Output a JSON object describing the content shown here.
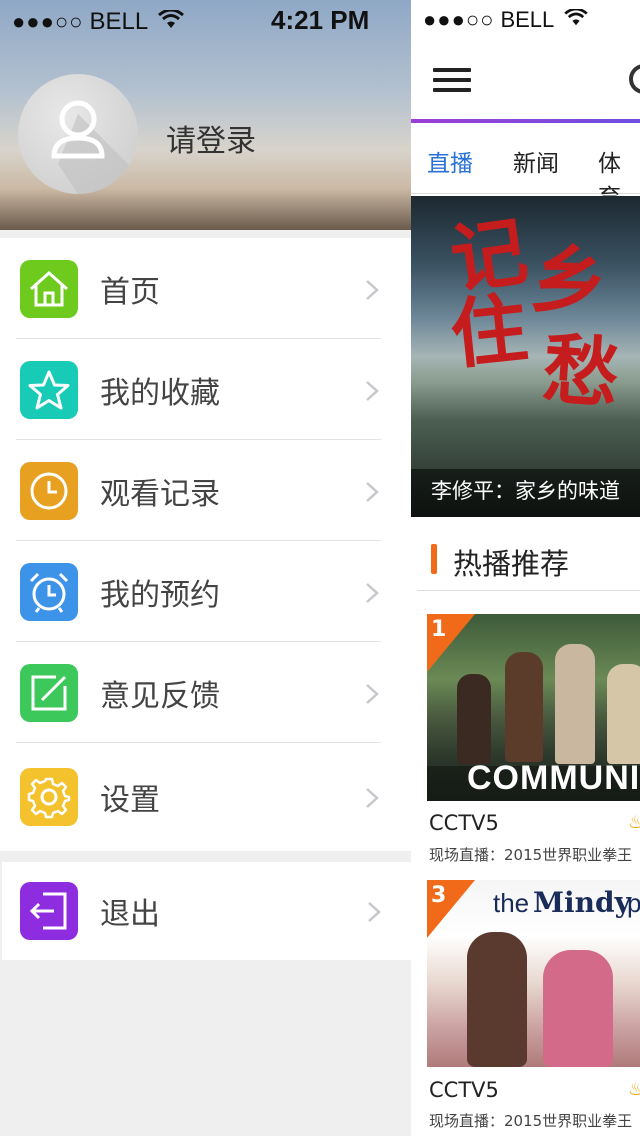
{
  "left_status": {
    "signal": "●●●○○",
    "carrier": "BELL",
    "time": "4:21 PM"
  },
  "profile": {
    "login_label": "请登录"
  },
  "menu": {
    "items": [
      {
        "label": "首页",
        "icon": "home-icon",
        "color": "#6ecb1e"
      },
      {
        "label": "我的收藏",
        "icon": "star-icon",
        "color": "#17cbb7"
      },
      {
        "label": "观看记录",
        "icon": "clock-icon",
        "color": "#e8a020"
      },
      {
        "label": "我的预约",
        "icon": "alarm-icon",
        "color": "#3d93e8"
      },
      {
        "label": "意见反馈",
        "icon": "edit-icon",
        "color": "#3cc85a"
      },
      {
        "label": "设置",
        "icon": "gear-icon",
        "color": "#f4c22c"
      }
    ],
    "exit": {
      "label": "退出",
      "icon": "logout-icon",
      "color": "#8e2de0"
    }
  },
  "right_status": {
    "signal": "●●●○○",
    "carrier": "BELL"
  },
  "tabs": [
    {
      "label": "直播",
      "active": true
    },
    {
      "label": "新闻",
      "active": false
    },
    {
      "label": "体育",
      "active": false
    }
  ],
  "banner": {
    "calligraphy": [
      "记",
      "住",
      "乡",
      "愁"
    ],
    "caption": "李修平：家乡的味道"
  },
  "section": {
    "title": "热播推荐"
  },
  "cards": [
    {
      "rank": "1",
      "channel": "CCTV5",
      "desc": "现场直播：2015世界职业拳王",
      "poster_text": "COMMUNITY"
    },
    {
      "rank": "3",
      "channel": "CCTV5",
      "desc": "现场直播：2015世界职业拳王",
      "poster_text_a": "the",
      "poster_text_b": "Mindy",
      "poster_text_c": "p"
    }
  ],
  "colors": {
    "accent": "#2a72d6",
    "orange": "#f06a1a",
    "purple": "#8e2de0"
  }
}
